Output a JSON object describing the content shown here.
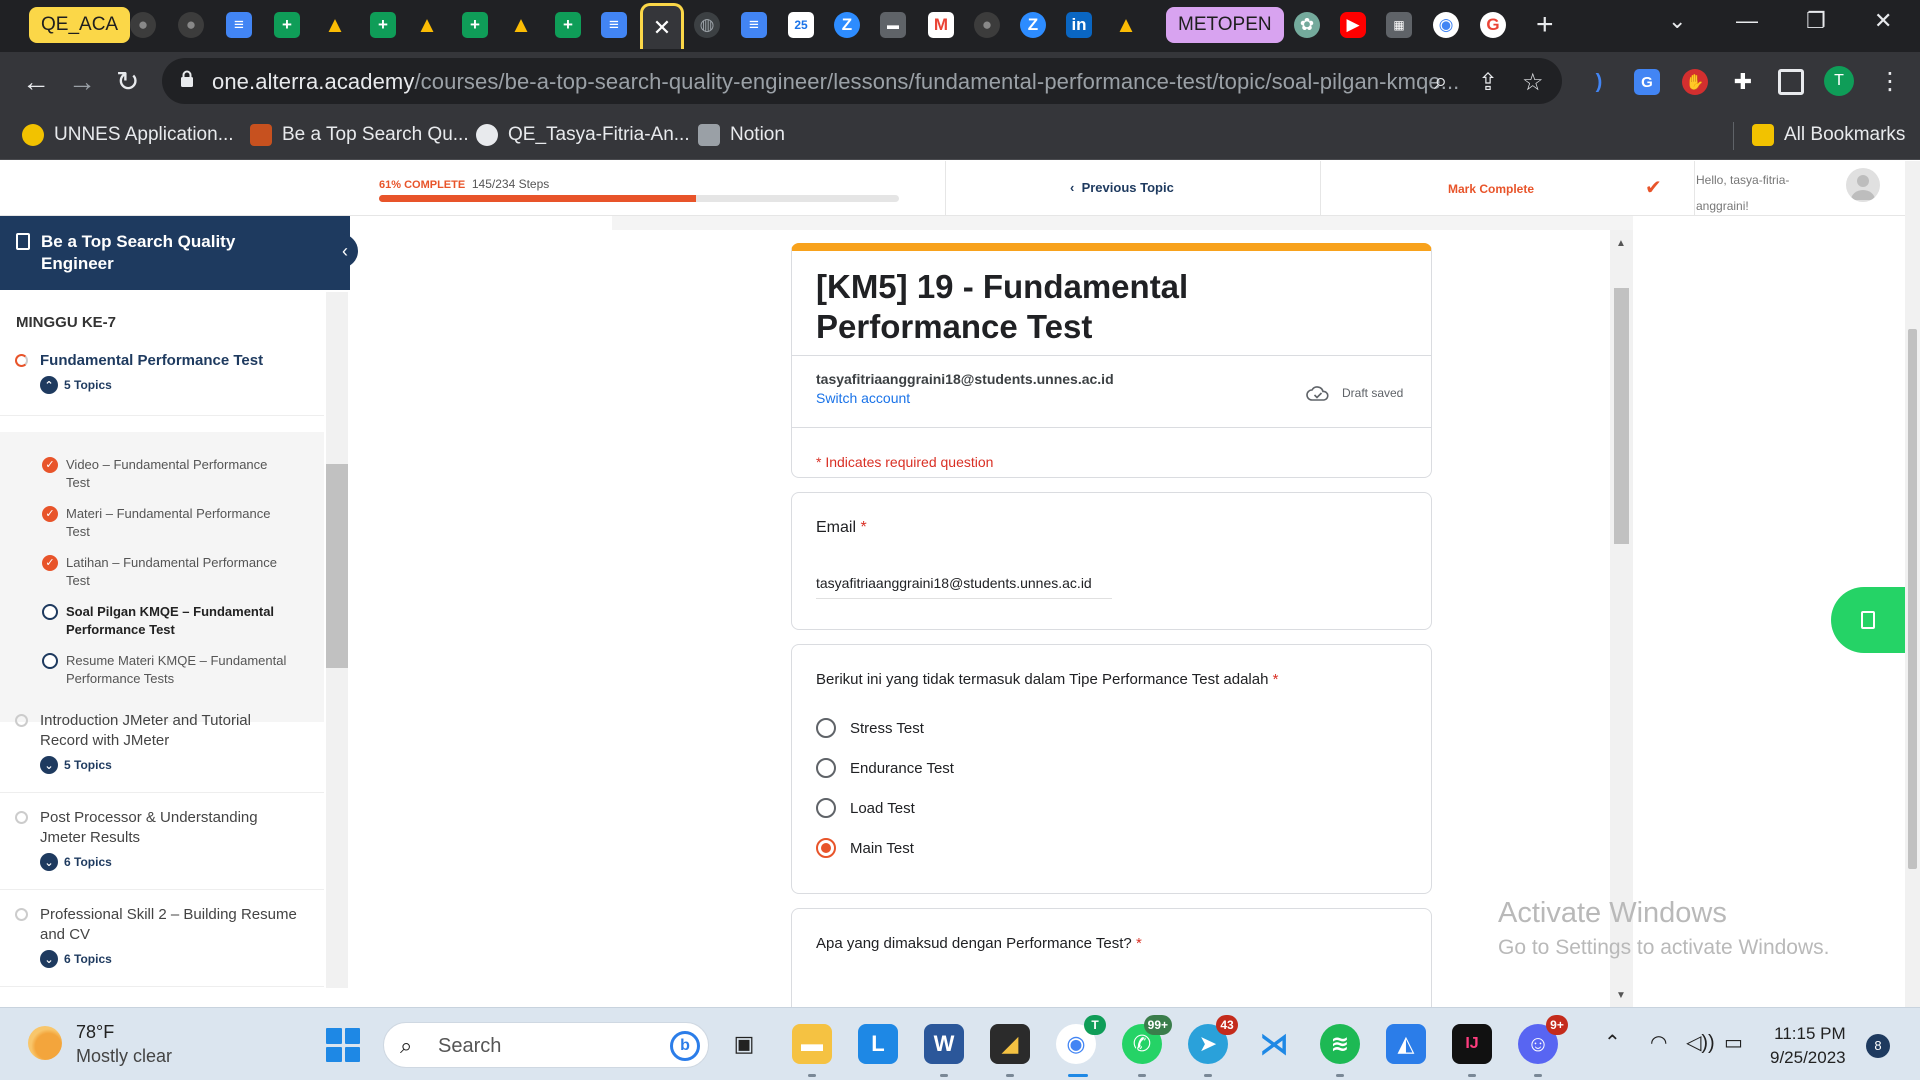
{
  "browser": {
    "tab_groups": {
      "group1": "QE_ACA",
      "group2": "METOPEN"
    },
    "active_tab_close": "✕",
    "new_tab": "+",
    "url_host": "one.alterra.academy",
    "url_path": "/courses/be-a-top-search-quality-engineer/lessons/fundamental-performance-test/topic/soal-pilgan-kmqe...",
    "bookmarks": [
      "UNNES Application...",
      "Be a Top Search Qu...",
      "QE_Tasya-Fitria-An...",
      "Notion"
    ],
    "all_bookmarks": "All Bookmarks",
    "profile_initial": "T",
    "tab_icons": [
      "github-icon",
      "github-icon",
      "docs-icon",
      "sheets-icon",
      "drive-icon",
      "sheets-icon",
      "drive-icon",
      "sheets-icon",
      "drive-icon",
      "sheets-icon",
      "docs-icon",
      "globe-icon",
      "docs-icon",
      "calendar-icon",
      "zoom-icon",
      "globe-icon",
      "gmail-icon",
      "github-icon",
      "zoom-icon",
      "linkedin-icon",
      "drive-icon",
      "chatgpt-icon",
      "youtube-icon",
      "tab-icon",
      "chrome-icon",
      "google-icon"
    ]
  },
  "topbar": {
    "progress_label": "61% COMPLETE",
    "progress_steps": "145/234 Steps",
    "progress_fraction": 0.61,
    "previous_topic": "Previous Topic",
    "mark_complete": "Mark Complete",
    "greeting": "Hello, tasya-fitria-anggraini!"
  },
  "sidebar": {
    "course_title": "Be a Top Search Quality Engineer",
    "week": "MINGGU KE-7",
    "current_lesson": {
      "title": "Fundamental Performance Test",
      "topics": "5 Topics"
    },
    "topics": [
      {
        "title": "Video – Fundamental Performance Test",
        "status": "done"
      },
      {
        "title": "Materi – Fundamental Performance Test",
        "status": "done"
      },
      {
        "title": "Latihan – Fundamental Performance Test",
        "status": "done"
      },
      {
        "title": "Soal Pilgan KMQE – Fundamental Performance Test",
        "status": "current"
      },
      {
        "title": "Resume Materi KMQE – Fundamental Performance Tests",
        "status": "open"
      }
    ],
    "lessons": [
      {
        "title": "Introduction JMeter and Tutorial Record with JMeter",
        "topics": "5 Topics"
      },
      {
        "title": "Post Processor & Understanding Jmeter Results",
        "topics": "6 Topics"
      },
      {
        "title": "Professional Skill 2 – Building Resume and CV",
        "topics": "6 Topics"
      }
    ]
  },
  "form": {
    "title": "[KM5] 19 - Fundamental Performance Test",
    "account_email": "tasyafitriaanggraini18@students.unnes.ac.id",
    "switch_account": "Switch account",
    "draft_status": "Draft saved",
    "required_note": "* Indicates required question",
    "email_question": "Email",
    "email_value": "tasyafitriaanggraini18@students.unnes.ac.id",
    "q1": {
      "text": "Berikut ini yang tidak termasuk dalam Tipe Performance Test adalah",
      "options": [
        "Stress Test",
        "Endurance Test",
        "Load Test",
        "Main Test"
      ],
      "selected": "Main Test"
    },
    "q2": {
      "text": "Apa yang dimaksud dengan Performance Test?"
    },
    "required_mark": "*"
  },
  "watermark": {
    "line1": "Activate Windows",
    "line2": "Go to Settings to activate Windows."
  },
  "taskbar": {
    "temperature": "78°F",
    "condition": "Mostly clear",
    "search_placeholder": "Search",
    "time": "11:15 PM",
    "date": "9/25/2023",
    "notification_count": "8",
    "badges": {
      "chrome": "T",
      "whatsapp": "99+",
      "telegram": "43",
      "discord": "9+"
    }
  },
  "colors": {
    "accent_orange": "#e8542a",
    "navy": "#1e3a5f",
    "form_header": "#f8a21c",
    "required_red": "#d93025"
  }
}
